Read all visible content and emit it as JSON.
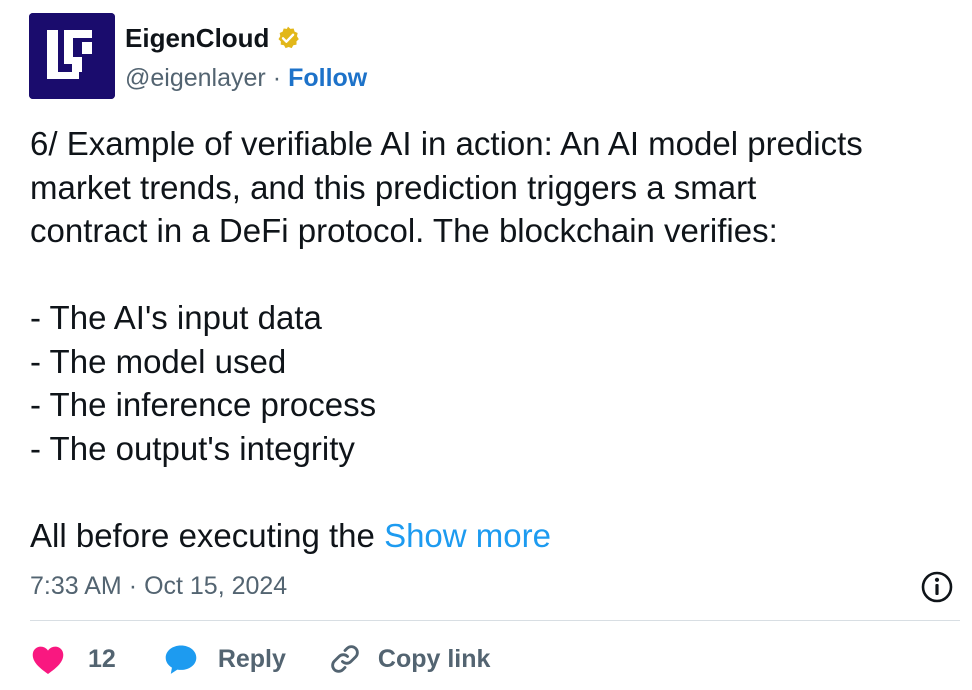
{
  "author": {
    "display_name": "EigenCloud",
    "handle": "@eigenlayer",
    "separator": "·",
    "follow_label": "Follow",
    "avatar_icon": "eigenlayer-logo",
    "verified_icon": "gold-verified-badge-icon"
  },
  "tweet": {
    "lines": [
      "6/ Example of verifiable AI in action: An AI model predicts",
      "market trends, and this prediction triggers a smart",
      "contract in a DeFi protocol. The blockchain verifies:",
      "- The AI's input data",
      "- The model used",
      "- The inference process",
      "- The output's integrity",
      "All before executing the "
    ],
    "show_more_label": "Show more"
  },
  "meta": {
    "time": "7:33 AM",
    "separator": "·",
    "date": "Oct 15, 2024",
    "info_icon": "info-icon"
  },
  "actions": {
    "like_count": "12",
    "reply_label": "Reply",
    "copy_link_label": "Copy link",
    "like_icon": "heart-icon",
    "reply_icon": "speech-bubble-icon",
    "copy_icon": "link-icon"
  },
  "colors": {
    "accent": "#1d9bf0",
    "follow": "#1d72c9",
    "like": "#f91880",
    "reply": "#1d9bf0",
    "avatar_bg": "#1a0c6d",
    "verified": "#e2b719",
    "text_secondary": "#536471"
  }
}
